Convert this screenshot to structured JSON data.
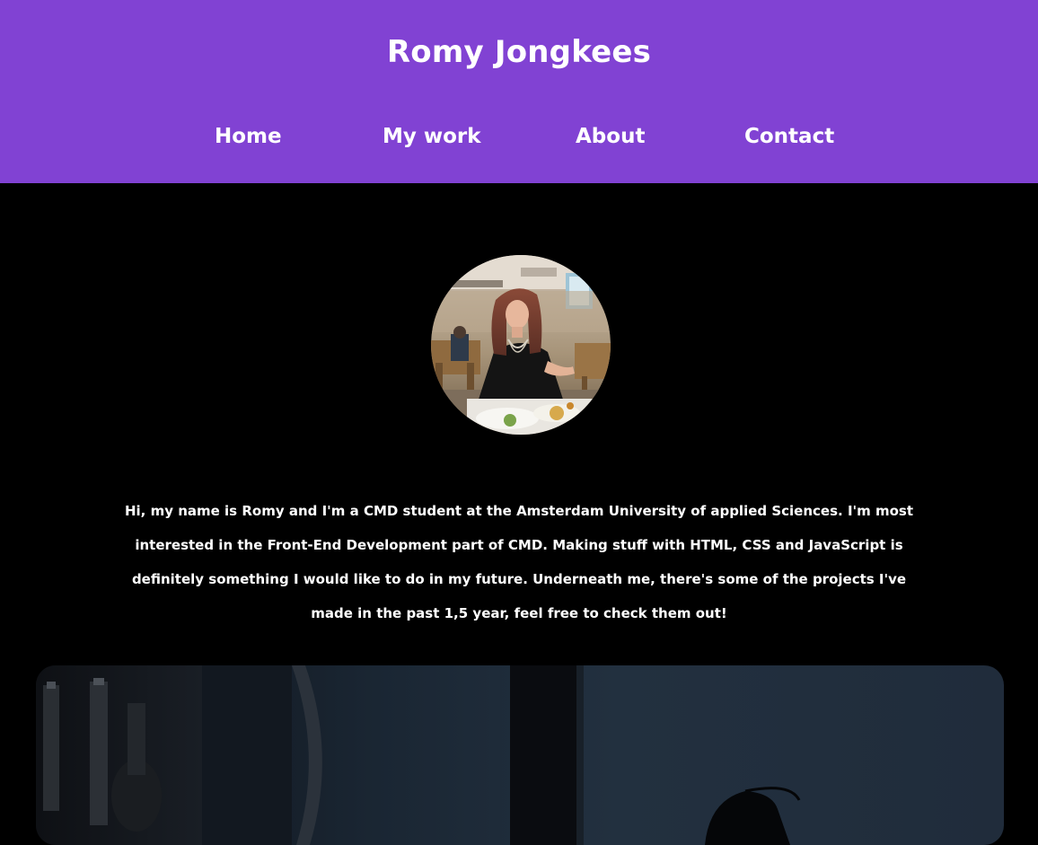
{
  "header": {
    "title": "Romy Jongkees",
    "nav": [
      {
        "label": "Home"
      },
      {
        "label": "My work"
      },
      {
        "label": "About"
      },
      {
        "label": "Contact"
      }
    ],
    "background": "#8142d3"
  },
  "main": {
    "intro": "Hi, my name is Romy and I'm a CMD student at the Amsterdam University of applied Sciences. I'm most interested in the Front-End Development part of CMD. Making stuff with HTML, CSS and JavaScript is definitely something I would like to do in my future. Underneath me, there's some of the projects I've made in the past 1,5 year, feel free to check them out!"
  },
  "colors": {
    "header_bg": "#8142d3",
    "page_bg": "#000000",
    "text": "#ffffff"
  },
  "icons": {
    "avatar": "profile-photo",
    "project": "project-thumbnail"
  }
}
